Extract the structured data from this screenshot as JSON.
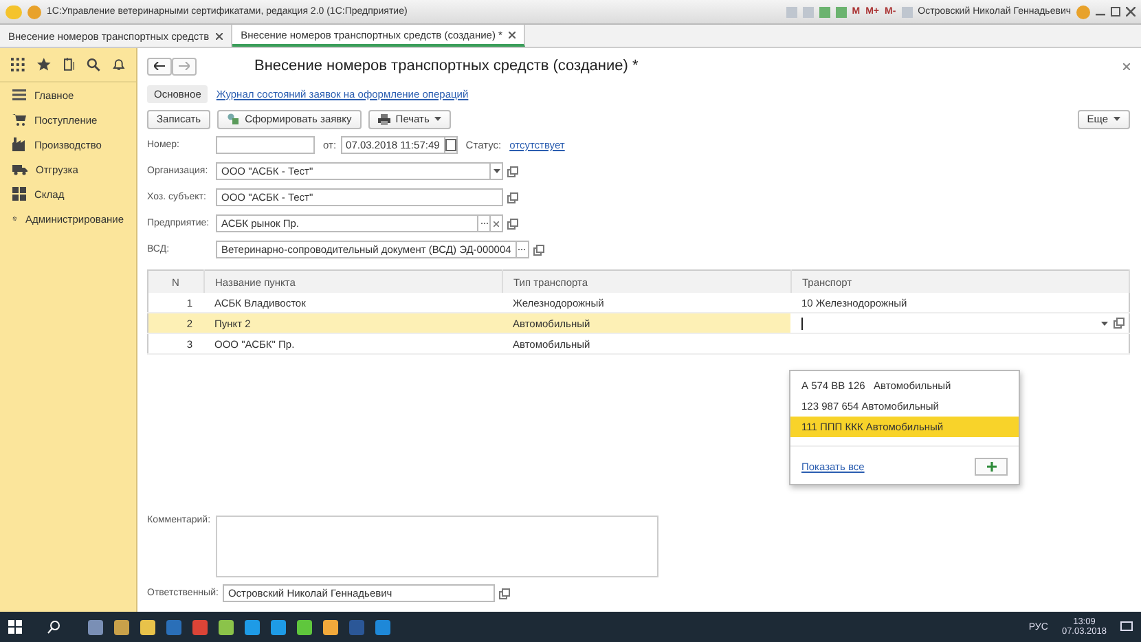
{
  "window": {
    "title": "1С:Управление ветеринарными сертификатами, редакция 2.0  (1С:Предприятие)",
    "memory_buttons": [
      "M",
      "M+",
      "M-"
    ],
    "user": "Островский Николай Геннадьевич"
  },
  "tabs": [
    {
      "label": "Внесение номеров транспортных средств",
      "selected": false
    },
    {
      "label": "Внесение номеров транспортных средств (создание) *",
      "selected": true
    }
  ],
  "sidebar": {
    "items": [
      {
        "label": "Главное",
        "kind": "menu"
      },
      {
        "label": "Поступление",
        "kind": "cart"
      },
      {
        "label": "Производство",
        "kind": "factory"
      },
      {
        "label": "Отгрузка",
        "kind": "truck"
      },
      {
        "label": "Склад",
        "kind": "grid"
      },
      {
        "label": "Администрирование",
        "kind": "gear"
      }
    ]
  },
  "form": {
    "title": "Внесение номеров транспортных средств (создание) *",
    "sections": [
      {
        "label": "Основное",
        "kind": "current"
      },
      {
        "label": "Журнал состояний заявок на оформление операций",
        "kind": "link"
      }
    ],
    "toolbar": [
      {
        "label": "Записать",
        "kind": "plain"
      },
      {
        "label": "Сформировать заявку",
        "kind": "request"
      },
      {
        "label": "Печать",
        "kind": "print"
      }
    ],
    "more_button": "Еще",
    "number": {
      "label": "Номер:",
      "date_label": "от:",
      "date": "07.03.2018 11:57:49",
      "status_label": "Статус:",
      "status": "отсутствует"
    },
    "fields": [
      {
        "label": "Организация:",
        "value": "ООО \"АСБК - Тест\"",
        "kind": "select"
      },
      {
        "label": "Хоз. субъект:",
        "value": "ООО \"АСБК - Тест\"",
        "kind": "open"
      },
      {
        "label": "Предприятие:",
        "value": "АСБК рынок Пр.",
        "kind": "choose-clear"
      },
      {
        "label": "ВСД:",
        "value": "Ветеринарно-сопроводительный документ (ВСД) ЭД-000004",
        "kind": "choose"
      }
    ],
    "table": {
      "columns": [
        "N",
        "Название пункта",
        "Тип транспорта",
        "Транспорт"
      ],
      "rows": [
        {
          "cells": [
            "1",
            "АСБК Владивосток",
            "Железнодорожный",
            "10 Железнодорожный"
          ],
          "selected": false
        },
        {
          "cells": [
            "2",
            "Пункт 2",
            "Автомобильный",
            ""
          ],
          "selected": true
        },
        {
          "cells": [
            "3",
            "ООО \"АСБК\" Пр.",
            "Автомобильный",
            ""
          ],
          "selected": false
        }
      ]
    },
    "dropdown": {
      "items": [
        {
          "label": "А 574 ВВ 126   Автомобильный",
          "selected": false
        },
        {
          "label": "123 987 654 Автомобильный",
          "selected": false
        },
        {
          "label": "111 ППП ККК Автомобильный",
          "selected": true
        }
      ],
      "show_all": "Показать все"
    },
    "comment": {
      "label": "Комментарий:"
    },
    "responsible": {
      "label": "Ответственный:",
      "value": "Островский Николай Геннадьевич"
    }
  },
  "taskbar": {
    "language": "РУС",
    "time": "13:09",
    "date": "07.03.2018"
  }
}
